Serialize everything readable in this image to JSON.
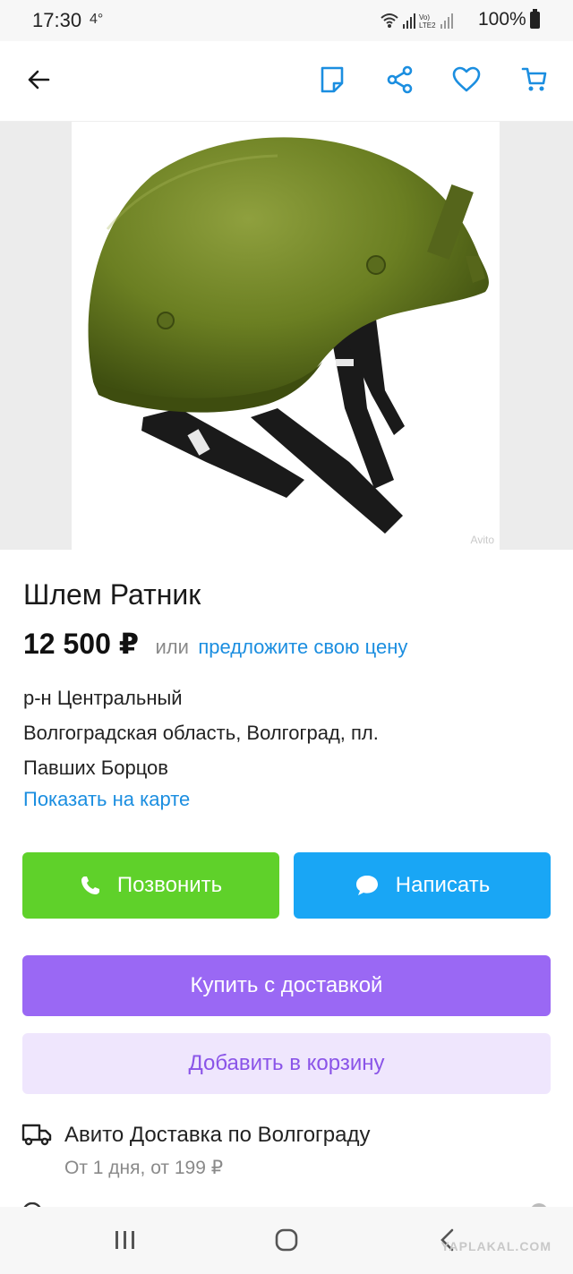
{
  "status_bar": {
    "time": "17:30",
    "temperature": "4°",
    "battery": "100%",
    "network_label": "Vo) LTE2"
  },
  "header": {
    "back_icon": "arrow-left-icon",
    "note_icon": "note-icon",
    "share_icon": "share-icon",
    "favorite_icon": "heart-icon",
    "cart_icon": "cart-icon",
    "icon_color": "#1b8ee0"
  },
  "photo": {
    "description_icon": "helmet-photo",
    "watermark": "Avito"
  },
  "listing": {
    "title": "Шлем Ратник",
    "price": "12 500 ₽",
    "price_or": "или",
    "price_offer": "предложите свою цену",
    "district": "р-н Центральный",
    "address_line1": "Волгоградская область, Волгоград, пл.",
    "address_line2": "Павших Борцов",
    "map_link": "Показать на карте"
  },
  "actions": {
    "call_label": "Позвонить",
    "write_label": "Написать",
    "buy_label": "Купить с доставкой",
    "cart_label": "Добавить в корзину"
  },
  "delivery": {
    "title": "Авито Доставка по Волгограду",
    "subtitle": "От 1 дня, от 199 ₽"
  },
  "site_watermark": "YAPLAKAL.COM",
  "colors": {
    "call_green": "#5fd12a",
    "write_blue": "#19a6f5",
    "buy_purple": "#9a68f4",
    "cart_lavender": "#efe6fd",
    "link_blue": "#1b8ee0"
  }
}
